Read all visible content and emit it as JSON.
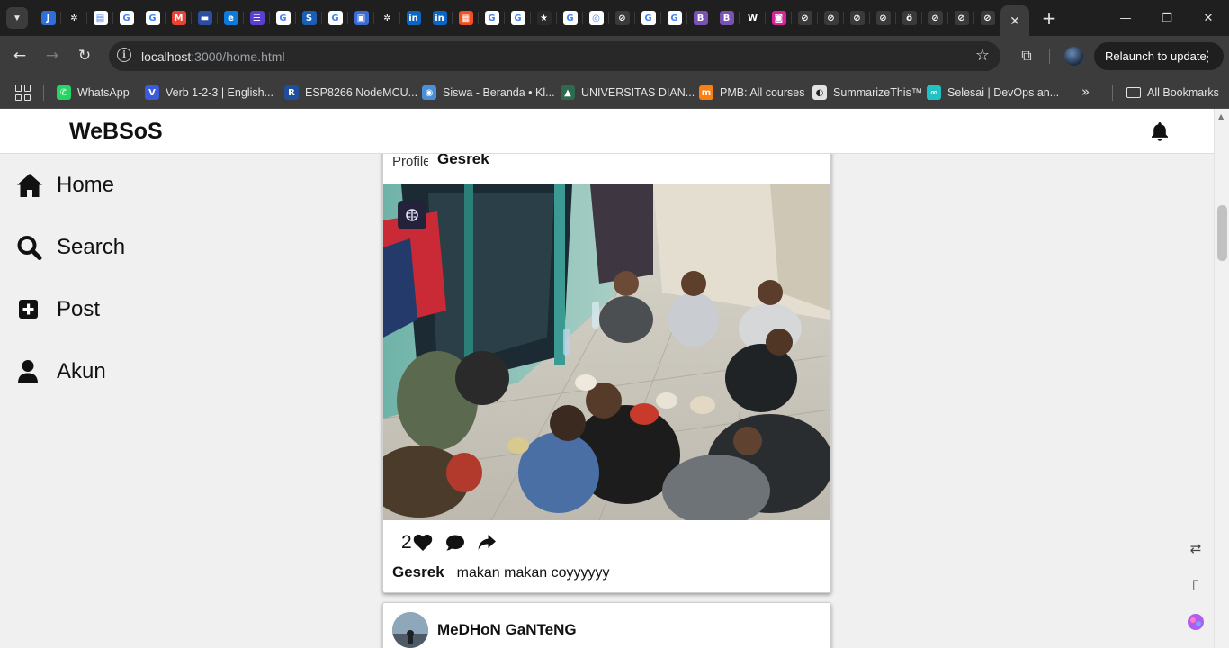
{
  "browser": {
    "tab_favicons": [
      {
        "name": "jira-icon",
        "color": "#2f6fd6",
        "glyph": "J"
      },
      {
        "name": "openai-icon",
        "color": "#1f1f1f",
        "glyph": "✲"
      },
      {
        "name": "doc-icon",
        "color": "#ffffff",
        "glyph": "▤"
      },
      {
        "name": "google-icon",
        "color": "#ffffff",
        "glyph": "G"
      },
      {
        "name": "google-icon",
        "color": "#ffffff",
        "glyph": "G"
      },
      {
        "name": "gmail-icon",
        "color": "#ea4335",
        "glyph": "M"
      },
      {
        "name": "bank-icon",
        "color": "#2b4ea2",
        "glyph": "▬"
      },
      {
        "name": "edge-icon",
        "color": "#0c7bdc",
        "glyph": "e"
      },
      {
        "name": "list-icon",
        "color": "#5b3fd1",
        "glyph": "☰"
      },
      {
        "name": "google-icon",
        "color": "#ffffff",
        "glyph": "G"
      },
      {
        "name": "s-icon",
        "color": "#1a5fb4",
        "glyph": "S"
      },
      {
        "name": "google-icon",
        "color": "#ffffff",
        "glyph": "G"
      },
      {
        "name": "form-icon",
        "color": "#3b6bd6",
        "glyph": "▣"
      },
      {
        "name": "openai-icon",
        "color": "#1f1f1f",
        "glyph": "✲"
      },
      {
        "name": "linkedin-icon",
        "color": "#0a66c2",
        "glyph": "in"
      },
      {
        "name": "linkedin-icon",
        "color": "#0a66c2",
        "glyph": "in"
      },
      {
        "name": "microsoft-icon",
        "color": "#f25022",
        "glyph": "▦"
      },
      {
        "name": "google-icon",
        "color": "#ffffff",
        "glyph": "G"
      },
      {
        "name": "google-icon",
        "color": "#ffffff",
        "glyph": "G"
      },
      {
        "name": "puzzle-icon",
        "color": "#2a2a2a",
        "glyph": "★"
      },
      {
        "name": "google-icon",
        "color": "#ffffff",
        "glyph": "G"
      },
      {
        "name": "github-icon",
        "color": "#ffffff",
        "glyph": "◎"
      },
      {
        "name": "globe-icon",
        "color": "#3a3a3a",
        "glyph": "⊘"
      },
      {
        "name": "google-icon",
        "color": "#ffffff",
        "glyph": "G"
      },
      {
        "name": "google-icon",
        "color": "#ffffff",
        "glyph": "G"
      },
      {
        "name": "bootstrap-icon",
        "color": "#7952b3",
        "glyph": "B"
      },
      {
        "name": "bootstrap-icon",
        "color": "#7952b3",
        "glyph": "B"
      },
      {
        "name": "w-icon",
        "color": "#1f1f1f",
        "glyph": "W"
      },
      {
        "name": "instagram-icon",
        "color": "#d6249f",
        "glyph": "◙"
      },
      {
        "name": "globe-icon",
        "color": "#3a3a3a",
        "glyph": "⊘"
      },
      {
        "name": "globe-icon",
        "color": "#3a3a3a",
        "glyph": "⊘"
      },
      {
        "name": "globe-icon",
        "color": "#3a3a3a",
        "glyph": "⊘"
      },
      {
        "name": "globe-icon",
        "color": "#3a3a3a",
        "glyph": "⊘"
      },
      {
        "name": "multicolor-icon",
        "color": "#3a3a3a",
        "glyph": "ô"
      },
      {
        "name": "globe-icon",
        "color": "#3a3a3a",
        "glyph": "⊘"
      },
      {
        "name": "globe-icon",
        "color": "#3a3a3a",
        "glyph": "⊘"
      },
      {
        "name": "globe-icon",
        "color": "#3a3a3a",
        "glyph": "⊘"
      }
    ],
    "active_tab_close": "✕",
    "new_tab": "+",
    "window_controls": {
      "minimize": "—",
      "restore": "❐",
      "close": "✕"
    },
    "url_host": "localhost",
    "url_path": ":3000/home.html",
    "relaunch_label": "Relaunch to update",
    "bookmarks": [
      {
        "label": "WhatsApp",
        "icon": "whatsapp-icon",
        "color": "#25d366",
        "glyph": "✆"
      },
      {
        "label": "Verb 1-2-3 | English...",
        "icon": "verb-icon",
        "color": "#3b5bdb",
        "glyph": "V"
      },
      {
        "label": "ESP8266 NodeMCU...",
        "icon": "r-icon",
        "color": "#1f4e9c",
        "glyph": "R"
      },
      {
        "label": "Siswa - Beranda • Kl...",
        "icon": "school-icon",
        "color": "#4a90d9",
        "glyph": "◉"
      },
      {
        "label": "UNIVERSITAS DIAN...",
        "icon": "university-icon",
        "color": "#2d6a4f",
        "glyph": "▲"
      },
      {
        "label": "PMB: All courses",
        "icon": "moodle-icon",
        "color": "#f98012",
        "glyph": "m"
      },
      {
        "label": "SummarizeThis™",
        "icon": "summarize-icon",
        "color": "#e3e3e3",
        "glyph": "◐"
      },
      {
        "label": "Selesai | DevOps an...",
        "icon": "infinity-icon",
        "color": "#22c1c3",
        "glyph": "∞"
      }
    ],
    "all_bookmarks": "All Bookmarks"
  },
  "app": {
    "brand": "WeBSoS",
    "nav": [
      {
        "id": "home",
        "label": "Home"
      },
      {
        "id": "search",
        "label": "Search"
      },
      {
        "id": "post",
        "label": "Post"
      },
      {
        "id": "akun",
        "label": "Akun"
      }
    ]
  },
  "posts": [
    {
      "author": "Gesrek",
      "profile_alt": "Profile",
      "likes": "2",
      "caption_user": "Gesrek",
      "caption_text": "makan makan coyyyyyy"
    },
    {
      "author": "MeDHoN GaNTeNG"
    }
  ]
}
